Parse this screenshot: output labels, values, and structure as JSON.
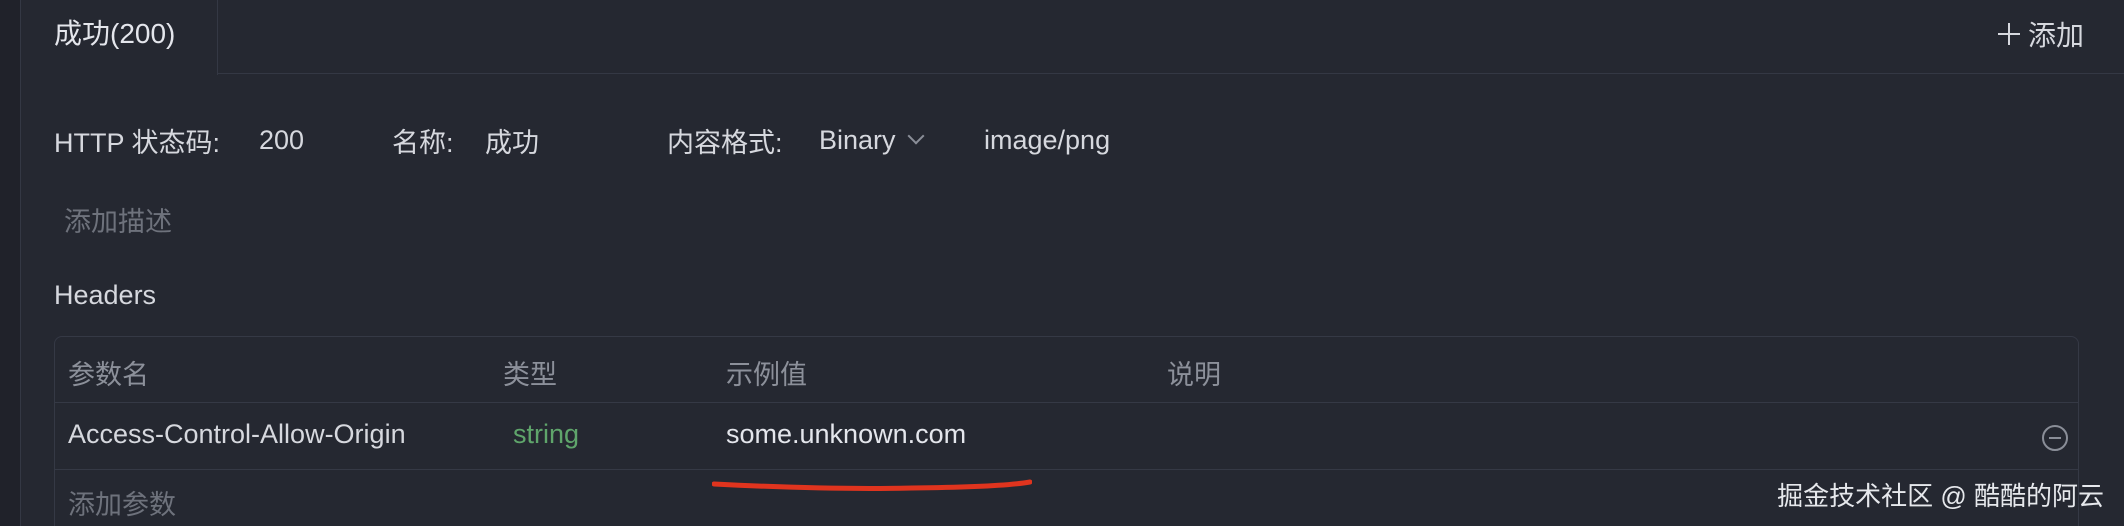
{
  "tabs": [
    {
      "label": "成功(200)",
      "active": true
    }
  ],
  "toolbar": {
    "add_label": "添加"
  },
  "meta": {
    "status_label": "HTTP 状态码:",
    "status_value": "200",
    "name_label": "名称:",
    "name_value": "成功",
    "format_label": "内容格式:",
    "format_value": "Binary",
    "mime_value": "image/png"
  },
  "add_description": "添加描述",
  "headers": {
    "title": "Headers",
    "columns": [
      "参数名",
      "类型",
      "示例值",
      "说明"
    ],
    "rows": [
      {
        "name": "Access-Control-Allow-Origin",
        "type": "string",
        "example": "some.unknown.com",
        "description": ""
      }
    ],
    "add_param": "添加参数"
  },
  "watermark": "掘金技术社区 @ 酷酷的阿云",
  "colors": {
    "background": "#20222a",
    "panel": "#252831",
    "type_string": "#5fa56b",
    "annotation_red": "#e0341e"
  }
}
